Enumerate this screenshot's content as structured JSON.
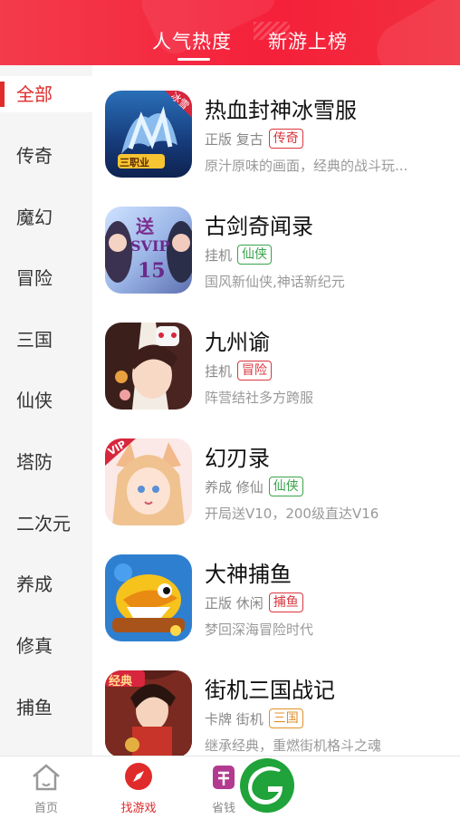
{
  "header": {
    "tabs": [
      {
        "label": "人气热度",
        "active": true
      },
      {
        "label": "新游上榜",
        "active": false
      }
    ]
  },
  "sidebar": {
    "items": [
      {
        "label": "全部",
        "active": true
      },
      {
        "label": "传奇"
      },
      {
        "label": "魔幻"
      },
      {
        "label": "冒险"
      },
      {
        "label": "三国"
      },
      {
        "label": "仙侠"
      },
      {
        "label": "塔防"
      },
      {
        "label": "二次元"
      },
      {
        "label": "养成"
      },
      {
        "label": "修真"
      },
      {
        "label": "捕鱼"
      }
    ]
  },
  "games": [
    {
      "title": "热血封神冰雪服",
      "tags": "正版 复古",
      "badge": "传奇",
      "badge_color": "red",
      "desc": "原汁原味的画面，经典的战斗玩...",
      "icon": "game-icon-ice-dragon",
      "icon_text": "三职业",
      "corner_text": "冰雪"
    },
    {
      "title": "古剑奇闻录",
      "tags": "挂机",
      "badge": "仙侠",
      "badge_color": "green",
      "desc": "国风新仙侠,神话新纪元",
      "icon": "game-icon-svip15",
      "icon_text": "SVIP",
      "icon_top": "送",
      "icon_num": "15"
    },
    {
      "title": "九州谕",
      "tags": "挂机",
      "badge": "冒险",
      "badge_color": "red",
      "desc": "阵营结社多方跨服",
      "icon": "game-icon-anime-girl"
    },
    {
      "title": "幻刃录",
      "tags": "养成 修仙",
      "badge": "仙侠",
      "badge_color": "green",
      "desc": "开局送V10，200级直达V16",
      "icon": "game-icon-fox-girl",
      "corner_text": "VIP"
    },
    {
      "title": "大神捕鱼",
      "tags": "正版 休闲",
      "badge": "捕鱼",
      "badge_color": "red",
      "desc": "梦回深海冒险时代",
      "icon": "game-icon-fish"
    },
    {
      "title": "街机三国战记",
      "tags": "卡牌 街机",
      "badge": "三国",
      "badge_color": "orange",
      "desc": "继承经典，重燃街机格斗之魂",
      "icon": "game-icon-warrior-girl",
      "corner_text": "经典"
    }
  ],
  "bottom_nav": [
    {
      "label": "首页",
      "icon": "home-icon",
      "active": false
    },
    {
      "label": "找游戏",
      "icon": "compass-icon",
      "active": true
    },
    {
      "label": "省钱",
      "icon": "coupon-icon",
      "active": false
    }
  ],
  "colors": {
    "accent": "#e02b2b",
    "header": "#f5203a",
    "green": "#3aa34a",
    "orange": "#e0902a"
  }
}
